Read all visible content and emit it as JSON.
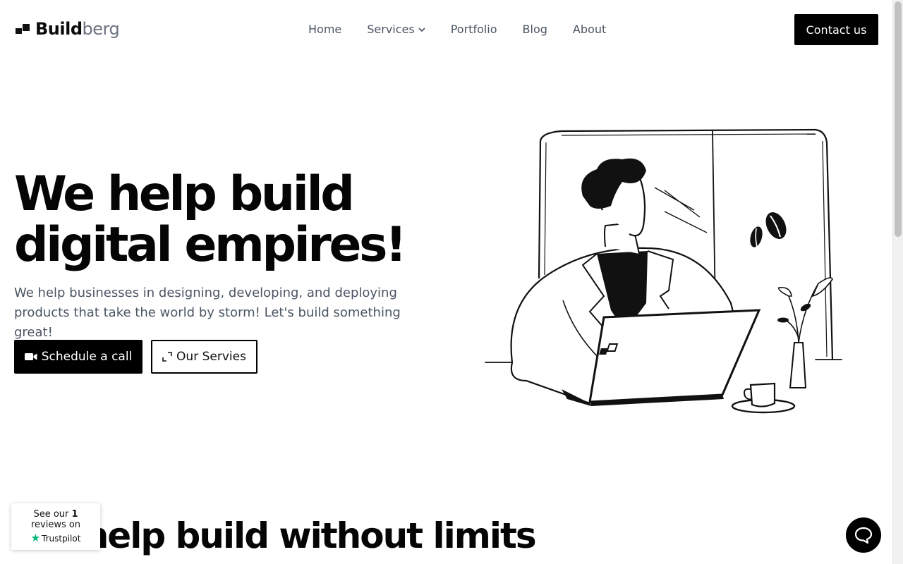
{
  "brand": {
    "name_strong": "Build",
    "name_light": "berg"
  },
  "nav": {
    "items": [
      {
        "label": "Home"
      },
      {
        "label": "Services"
      },
      {
        "label": "Portfolio"
      },
      {
        "label": "Blog"
      },
      {
        "label": "About"
      }
    ],
    "services_icon": "chevron-down-icon"
  },
  "header": {
    "contact_label": "Contact us"
  },
  "hero": {
    "title_line1": "We help build",
    "title_line2": "digital empires!",
    "subtitle": "We help businesses in designing, developing, and deploying products that take the world by storm! Let's build something great!",
    "primary_label": "Schedule a call",
    "primary_icon": "video-camera-icon",
    "secondary_label": "Our Servies",
    "secondary_icon": "expand-icon"
  },
  "section2": {
    "title": "We help build without limits"
  },
  "trustpilot": {
    "prefix": "See our",
    "count": "1",
    "suffix": "reviews on",
    "brand": "Trustpilot"
  },
  "chat": {
    "icon": "chat-bubble-icon"
  },
  "colors": {
    "primary": "#000000",
    "text_muted": "#4b5563",
    "trustpilot_green": "#00b67a"
  }
}
